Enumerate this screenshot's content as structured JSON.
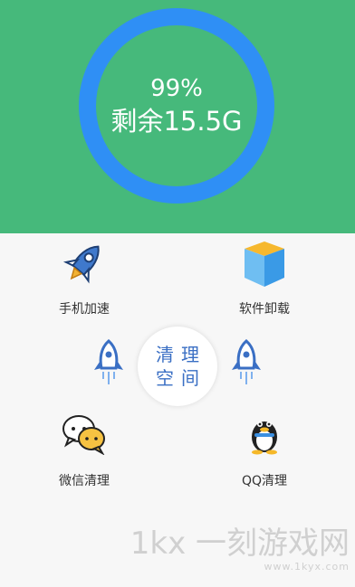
{
  "storage": {
    "percent": "99%",
    "remaining": "剩余15.5G"
  },
  "colors": {
    "header_bg": "#46b97b",
    "ring": "#2f8ff5",
    "accent_text": "#3a6fc4"
  },
  "items": {
    "speedup": {
      "label": "手机加速",
      "icon": "rocket-icon"
    },
    "uninstall": {
      "label": "软件卸载",
      "icon": "box-icon"
    },
    "wechat": {
      "label": "微信清理",
      "icon": "wechat-icon"
    },
    "qq": {
      "label": "QQ清理",
      "icon": "qq-penguin-icon"
    }
  },
  "center_button": {
    "line1": "清理",
    "line2": "空间"
  },
  "watermark": {
    "main": "1kx 一刻游戏网",
    "url": "www.1kyx.com"
  }
}
